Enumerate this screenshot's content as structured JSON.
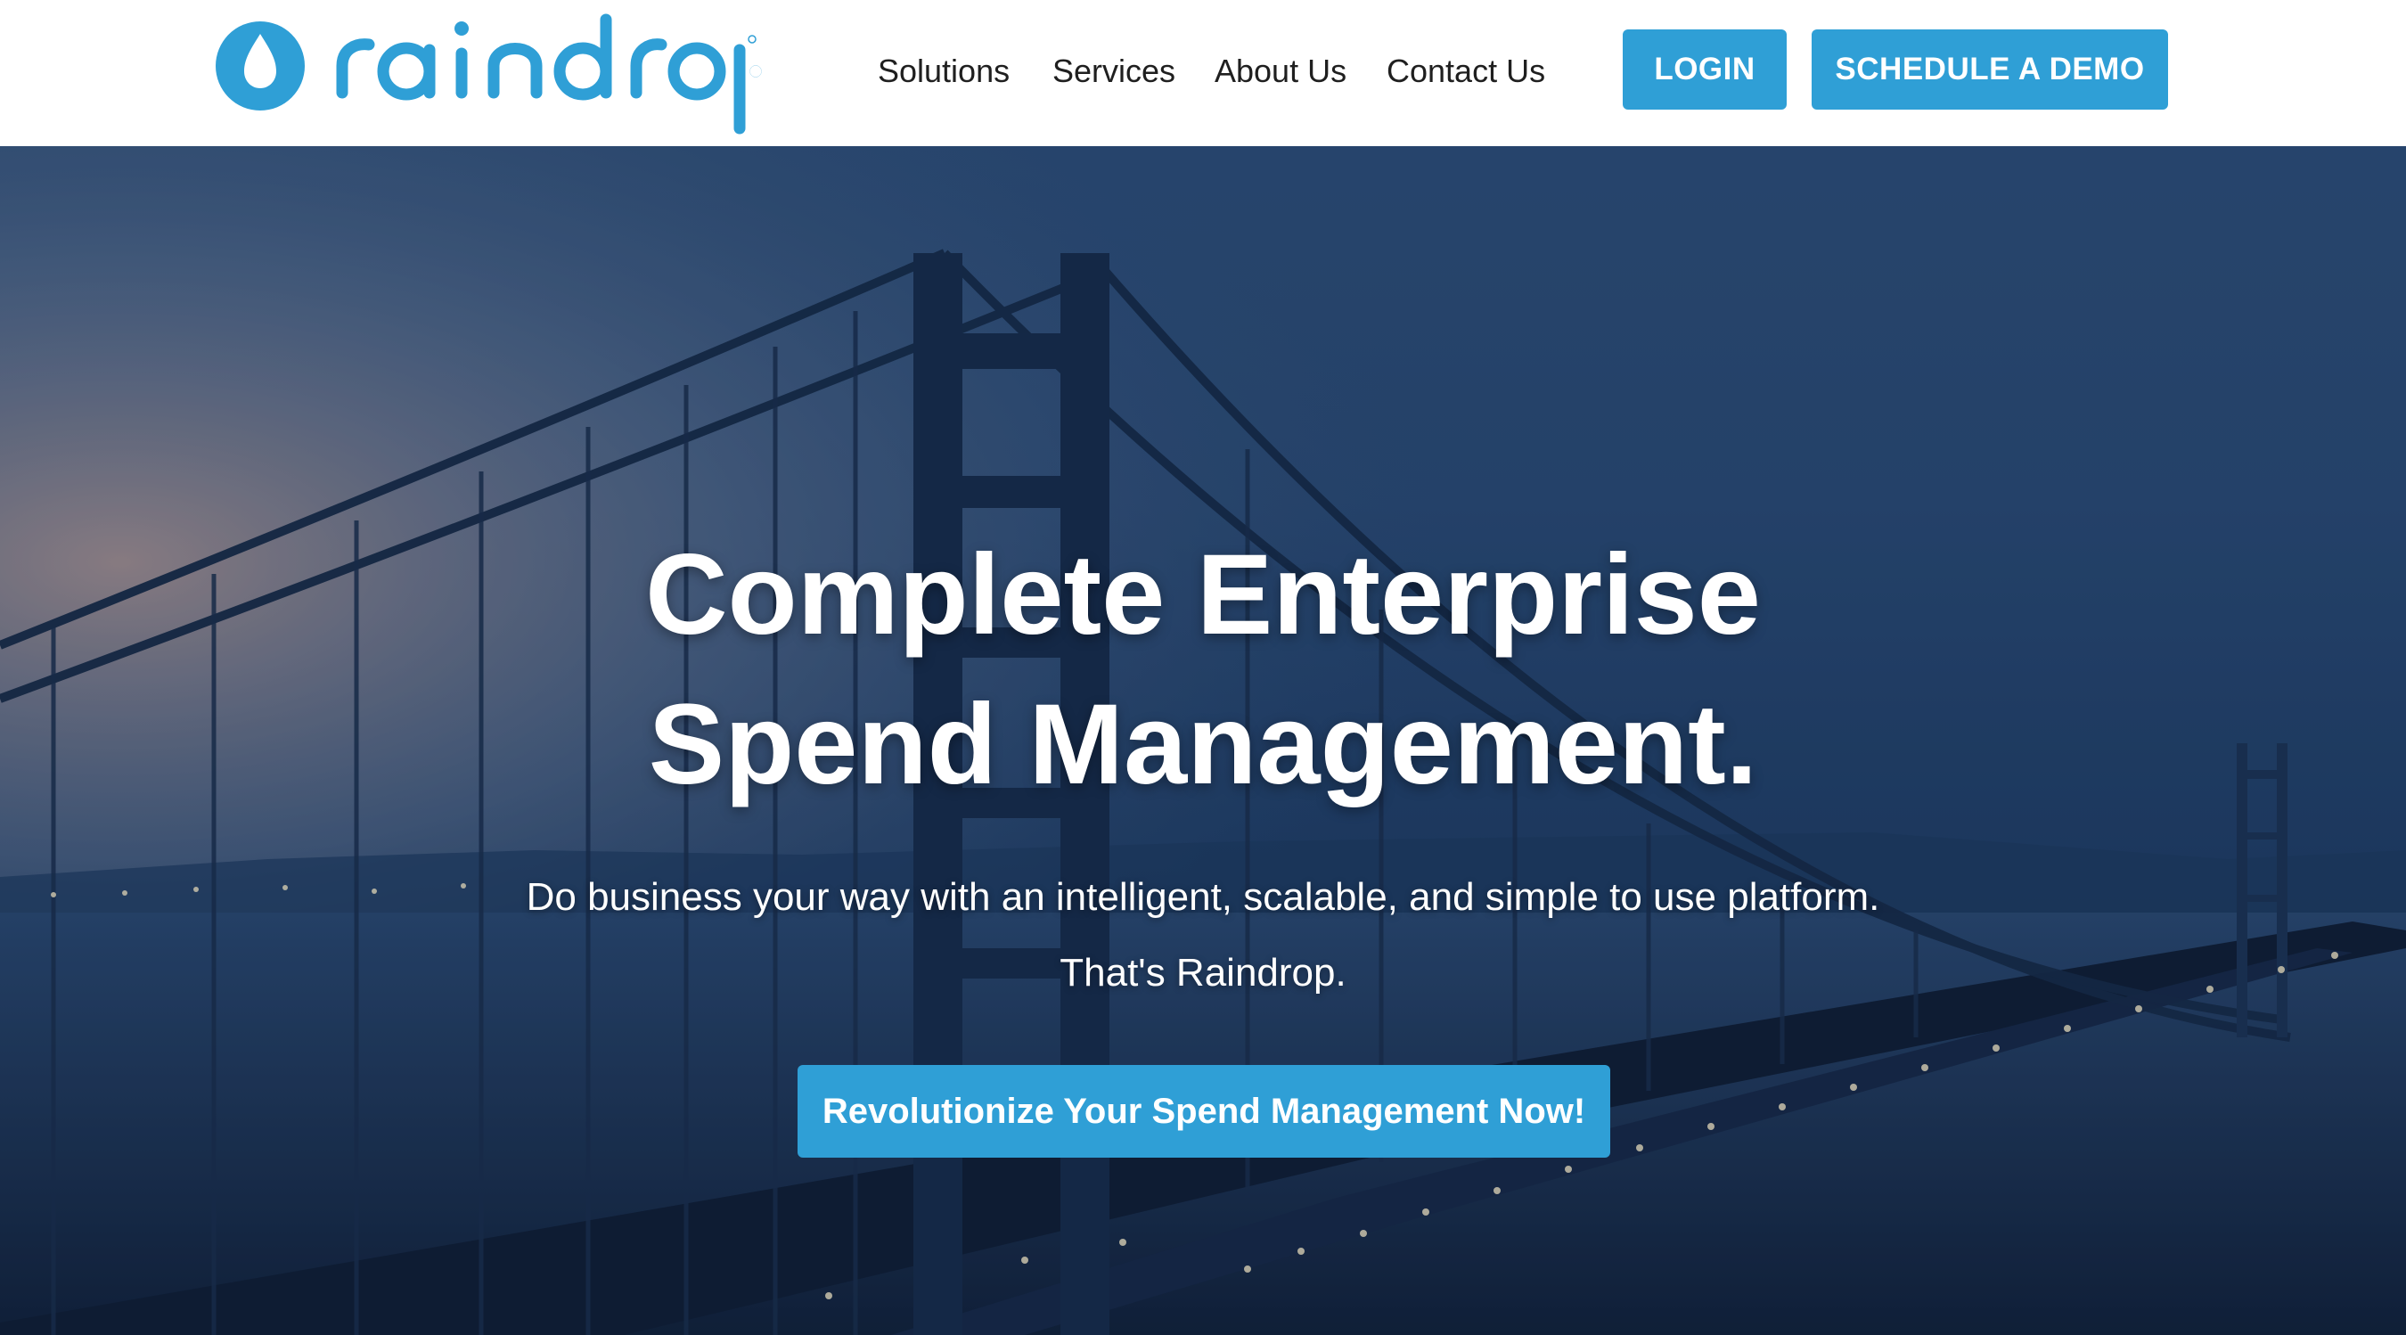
{
  "header": {
    "logo_text": "raindrop",
    "nav": [
      {
        "label": "Solutions"
      },
      {
        "label": "Services"
      },
      {
        "label": "About Us"
      },
      {
        "label": "Contact Us"
      }
    ],
    "login_label": "LOGIN",
    "demo_label": "SCHEDULE A DEMO"
  },
  "hero": {
    "title_line1": "Complete Enterprise",
    "title_line2": "Spend Management.",
    "subtitle_line1": "Do business your way with an intelligent, scalable, and simple to use platform.",
    "subtitle_line2": "That's Raindrop.",
    "cta_label": "Revolutionize Your Spend Management Now!",
    "background": "golden-gate-bridge-night-photo"
  },
  "colors": {
    "accent": "#2f9fd6",
    "nav_text": "#1f1f1f",
    "hero_text": "#ffffff"
  }
}
